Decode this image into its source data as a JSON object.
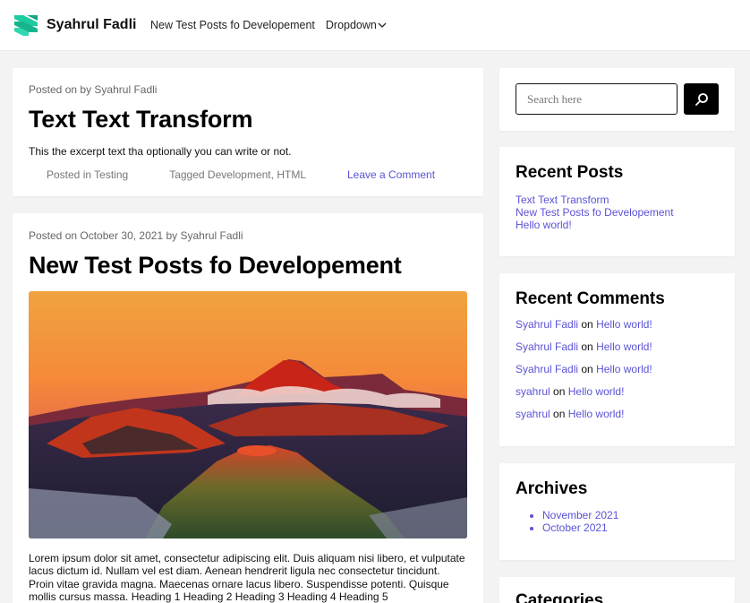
{
  "header": {
    "site_name": "Syahrul Fadli",
    "nav": [
      {
        "label": "New Test Posts fo Developement"
      },
      {
        "label": "Dropdown"
      }
    ]
  },
  "posts": [
    {
      "meta_prefix": "Posted on",
      "meta_date": "",
      "meta_by": "by",
      "meta_author": "Syahrul Fadli",
      "title": "Text Text Transform",
      "excerpt": "This the excerpt text tha optionally you can write or not.",
      "posted_in_label": "Posted in",
      "category": "Testing",
      "tagged_label": "Tagged",
      "tag1": "Development",
      "tag_sep": ",",
      "tag2": "HTML",
      "comment_link": "Leave a Comment"
    },
    {
      "meta_prefix": "Posted on",
      "meta_date": "October 30, 2021",
      "meta_by": "by",
      "meta_author": "Syahrul Fadli",
      "title": "New Test Posts fo Developement",
      "image_alt": "volcano landscape at sunset",
      "content": "Lorem ipsum dolor sit amet, consectetur adipiscing elit. Duis aliquam nisi libero, et vulputate lacus dictum id. Nullam vel est diam. Aenean hendrerit ligula nec consectetur tincidunt. Proin vitae gravida magna. Maecenas ornare lacus libero. Suspendisse potenti. Quisque mollis cursus massa. Heading 1 Heading 2 Heading 3 Heading 4 Heading 5"
    }
  ],
  "sidebar": {
    "search": {
      "placeholder": "Search here",
      "icon": "search-icon"
    },
    "recent_posts": {
      "title": "Recent Posts",
      "items": [
        "Text Text Transform",
        "New Test Posts fo Developement",
        "Hello world!"
      ]
    },
    "recent_comments": {
      "title": "Recent Comments",
      "connector": "on",
      "items": [
        {
          "author": "Syahrul Fadli",
          "post": "Hello world!"
        },
        {
          "author": "Syahrul Fadli",
          "post": "Hello world!"
        },
        {
          "author": "Syahrul Fadli",
          "post": "Hello world!"
        },
        {
          "author": "syahrul",
          "post": "Hello world!"
        },
        {
          "author": "syahrul",
          "post": "Hello world!"
        }
      ]
    },
    "archives": {
      "title": "Archives",
      "items": [
        "November 2021",
        "October 2021"
      ]
    },
    "categories": {
      "title": "Categories"
    }
  },
  "colors": {
    "accent": "#5a52d6",
    "logo_green": "#19c39c",
    "background": "#f3f3f3"
  }
}
